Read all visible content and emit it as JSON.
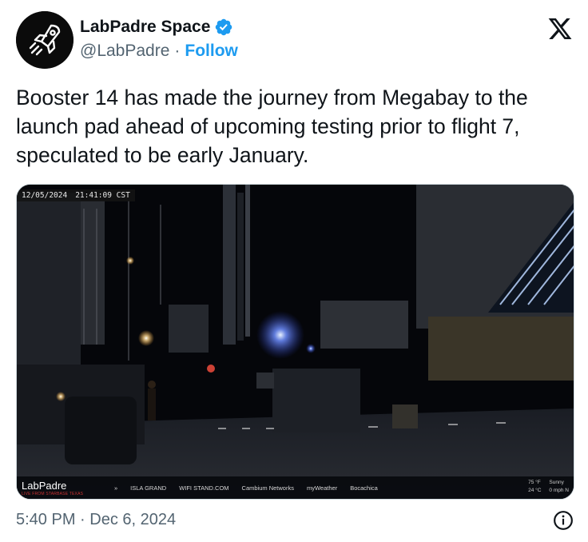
{
  "author": {
    "display_name": "LabPadre Space",
    "handle": "@LabPadre",
    "separator": "·",
    "follow_label": "Follow",
    "verified": true,
    "verified_color": "#1d9bf0"
  },
  "tweet": {
    "text": "Booster 14 has made the journey from Megabay to the launch pad ahead of upcoming testing prior to flight 7, speculated to be early January.",
    "timestamp": "5:40 PM · Dec 6, 2024"
  },
  "media": {
    "overlay_date": "12/05/2024",
    "overlay_time": "21:41:09 CST",
    "brand_name": "LabPadre",
    "brand_sub": "LIVE FROM STARBASE TEXAS",
    "sponsors": [
      "»",
      "ISLA GRAND",
      "WIFI STAND.COM",
      "Cambium Networks",
      "myWeather",
      "Bocachica"
    ],
    "weather": {
      "temp_f": "75 °F",
      "temp_c": "24 °C",
      "condition": "Sunny",
      "wind": "0 mph N"
    }
  },
  "icons": {
    "avatar": "rocket-avatar-icon",
    "verified": "verified-badge-icon",
    "platform": "x-logo-icon",
    "info": "info-icon"
  },
  "colors": {
    "accent": "#1d9bf0",
    "text_primary": "#0f1419",
    "text_secondary": "#536471"
  }
}
